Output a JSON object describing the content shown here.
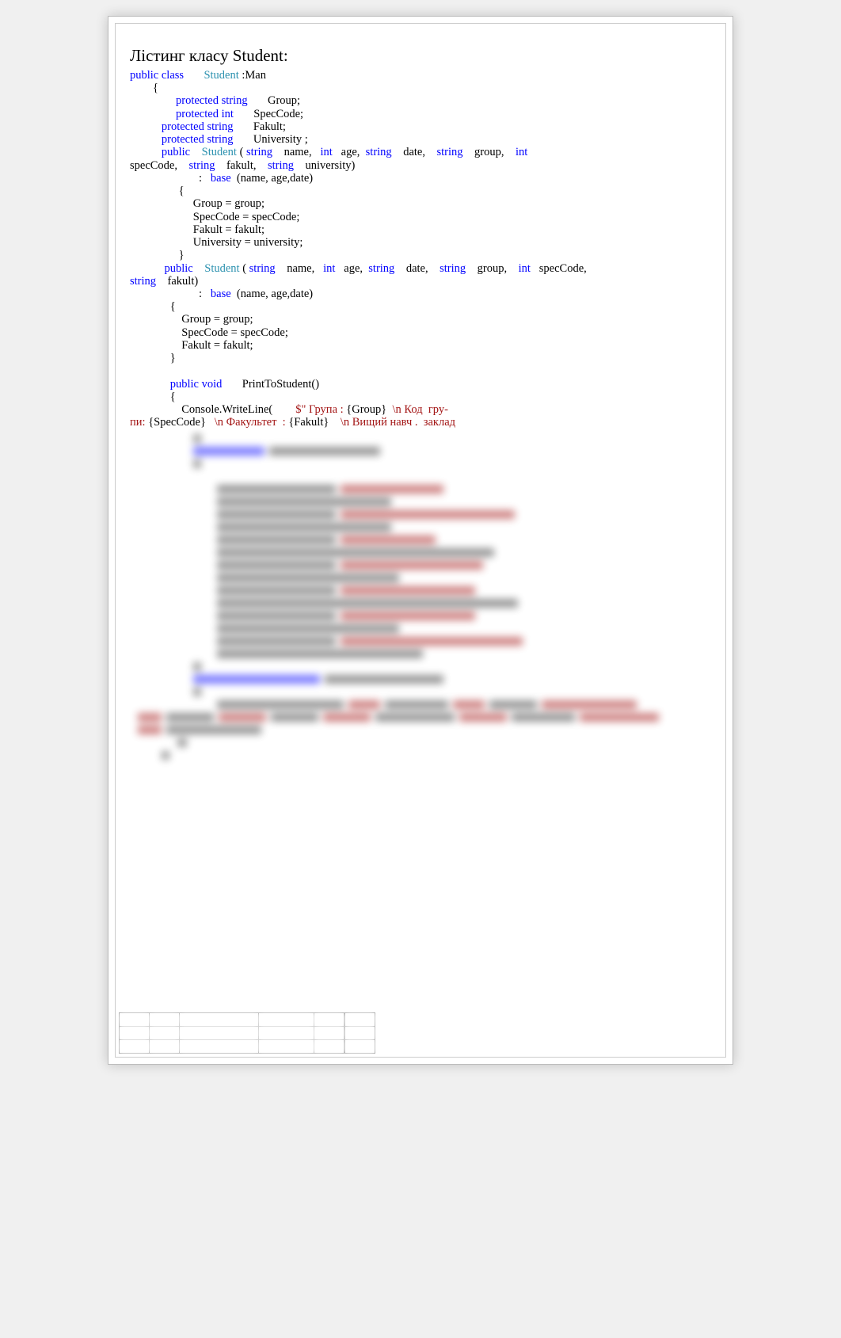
{
  "heading": "Лістинг класу Student:",
  "code": {
    "line1": {
      "kw1": "public class",
      "type1": "Student",
      "rest": " :Man"
    },
    "line2": "        {",
    "line3": {
      "indent": "                ",
      "kw": "protected string",
      "rest": "       Group;"
    },
    "line4": {
      "indent": "                ",
      "kw": "protected int",
      "rest": "       SpecCode;"
    },
    "line5": {
      "indent": "           ",
      "kw": "protected string",
      "rest": "       Fakult;"
    },
    "line6": {
      "indent": "           ",
      "kw": "protected string",
      "rest": "       University ;"
    },
    "line7": {
      "indent": "           ",
      "kw1": "public",
      "type1": "Student",
      "p1": " ( ",
      "kw2": "string",
      "p2": "    name,   ",
      "kw3": "int",
      "p3": "   age,  ",
      "kw4": "string",
      "p4": "    date,    ",
      "kw5": "string",
      "p5": "    group,    ",
      "kw6": "int",
      "p6": "   "
    },
    "line8": {
      "p0": "specCode,    ",
      "kw1": "string",
      "p1": "    fakult,    ",
      "kw2": "string",
      "p2": "    university)"
    },
    "line9": {
      "indent": "                        :   ",
      "kw": "base",
      "rest": "  (name, age,date)"
    },
    "line10": "                 {",
    "line11": "                      Group = group;",
    "line12": "                      SpecCode = specCode;",
    "line13": "                      Fakult = fakult;",
    "line14": "                      University = university;",
    "line15": "                 }",
    "line16": {
      "indent": "            ",
      "kw1": "public",
      "type1": "Student",
      "p1": " ( ",
      "kw2": "string",
      "p2": "    name,   ",
      "kw3": "int",
      "p3": "   age,  ",
      "kw4": "string",
      "p4": "    date,    ",
      "kw5": "string",
      "p5": "    group,    ",
      "kw6": "int",
      "p6": "   specCode,"
    },
    "line17": {
      "kw1": "string",
      "rest": "    fakult)"
    },
    "line18": {
      "indent": "                        :   ",
      "kw": "base",
      "rest": "  (name, age,date)"
    },
    "line19": "              {",
    "line20": "                  Group = group;",
    "line21": "                  SpecCode = specCode;",
    "line22": "                  Fakult = fakult;",
    "line23": "              }",
    "line24": "",
    "line25": {
      "indent": "              ",
      "kw": "public void",
      "rest": "       PrintToStudent()"
    },
    "line26": "              {",
    "line27": {
      "indent": "                  ",
      "p0": "Console.WriteLine(        ",
      "str1": "$\" Група : ",
      "p1": "{Group}  ",
      "str2": "\\n Код  гру-"
    },
    "line28": {
      "str1": "пи: ",
      "p1": "{SpecCode}   ",
      "str2": "\\n Факультет  : ",
      "p2": "{Fakult}    ",
      "str3": "\\n Вищий навч .  заклад"
    }
  }
}
